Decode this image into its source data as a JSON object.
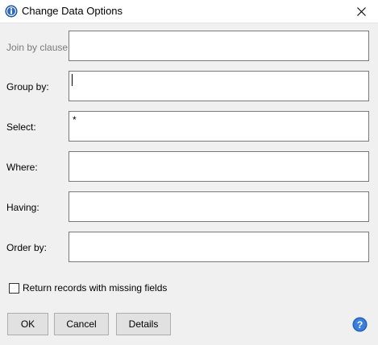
{
  "window": {
    "title": "Change Data Options"
  },
  "fields": [
    {
      "label": "Join by clause:",
      "value": "",
      "enabled": false
    },
    {
      "label": "Group by:",
      "value": "",
      "enabled": true
    },
    {
      "label": "Select:",
      "value": "*",
      "enabled": true
    },
    {
      "label": "Where:",
      "value": "",
      "enabled": true
    },
    {
      "label": "Having:",
      "value": "",
      "enabled": true
    },
    {
      "label": "Order by:",
      "value": "",
      "enabled": true
    }
  ],
  "options": {
    "missing_fields_label": "Return records with missing fields",
    "missing_fields_checked": false
  },
  "buttons": {
    "ok": "OK",
    "cancel": "Cancel",
    "details": "Details"
  },
  "icons": {
    "app": "info-icon",
    "close": "close-icon",
    "help": "help-icon"
  },
  "colors": {
    "accent_blue": "#1f5fbf",
    "disabled_text": "#7a7a7a"
  }
}
